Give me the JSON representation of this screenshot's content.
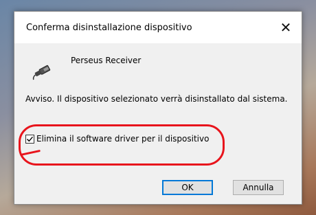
{
  "dialog": {
    "title": "Conferma disinstallazione dispositivo",
    "close_glyph": "✕",
    "device_name": "Perseus Receiver",
    "device_icon": "usb-cable-icon",
    "warning_text": "Avviso. Il dispositivo selezionato verrà disinstallato dal sistema.",
    "checkbox": {
      "label": "Elimina il software driver per il dispositivo",
      "checked": true
    },
    "buttons": {
      "ok_label": "OK",
      "cancel_label": "Annulla"
    }
  },
  "annotation": {
    "color": "#e8141c"
  }
}
